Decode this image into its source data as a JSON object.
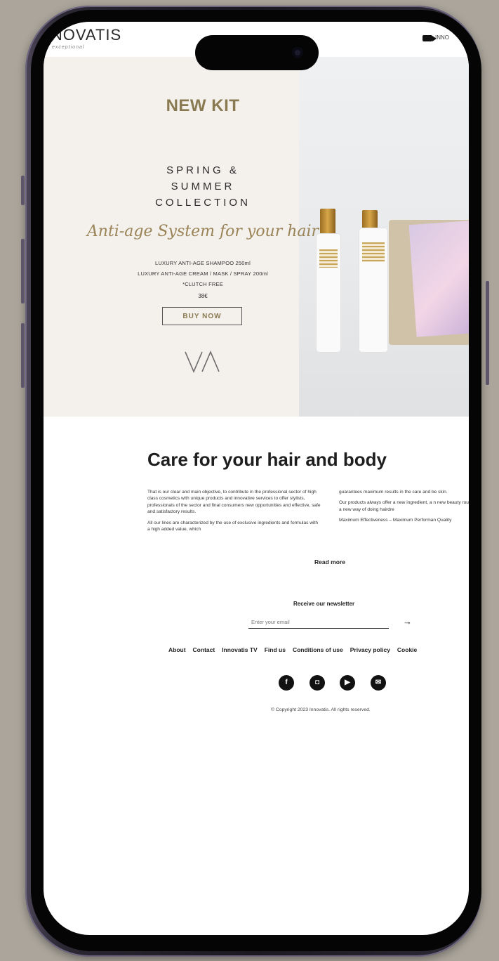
{
  "header": {
    "logo": "NNOVATIS",
    "logo_sub": "exceptional",
    "link": "INNO"
  },
  "hero": {
    "title": "NEW KIT",
    "subtitle_lines": [
      "SPRING &",
      "SUMMER",
      "COLLECTION"
    ],
    "script": "Anti-age System for your hair",
    "product_lines": [
      "LUXURY ANTI-AGE SHAMPOO 250ml",
      "LUXURY ANTI-AGE CREAM / MASK / SPRAY 200ml",
      "*CLUTCH FREE"
    ],
    "price": "38€",
    "button": "BUY NOW",
    "mark": "VA"
  },
  "content": {
    "title": "Care for your hair and body",
    "left_paragraphs": [
      "That is our clear and main objective, to contribute in the professional sector of high class cosmetics with unique products and innovative services to offer stylists, professionals of the sector and final consumers new opportunities and effective, safe and satisfactory results.",
      "All our lines are characterized by the use of exclusive ingredients and formulas with a high added value, which"
    ],
    "right_paragraphs": [
      "guarantees maximum results in the care and be skin.",
      "Our products always offer a new ingredient, a n new beauty routine, a new way of doing hairdre",
      "Maximum Effectiveness – Maximum Performan Quality"
    ],
    "read_more": "Read more"
  },
  "newsletter": {
    "label": "Receive our newsletter",
    "placeholder": "Enter your email",
    "arrow": "→"
  },
  "footer": {
    "links": [
      "About",
      "Contact",
      "Innovatis TV",
      "Find us",
      "Conditions of use",
      "Privacy policy",
      "Cookie"
    ],
    "social": [
      {
        "icon": "facebook-icon",
        "glyph": "f"
      },
      {
        "icon": "instagram-icon",
        "glyph": "◘"
      },
      {
        "icon": "youtube-icon",
        "glyph": "▶"
      },
      {
        "icon": "email-icon",
        "glyph": "✉"
      }
    ],
    "copyright": "© Copyright 2023 Innovatis. All rights reserved."
  },
  "colors": {
    "background": "#aba59b",
    "gold": "#8a7a52",
    "hero_bg": "#f4f1ec",
    "text": "#1e1e1e"
  }
}
